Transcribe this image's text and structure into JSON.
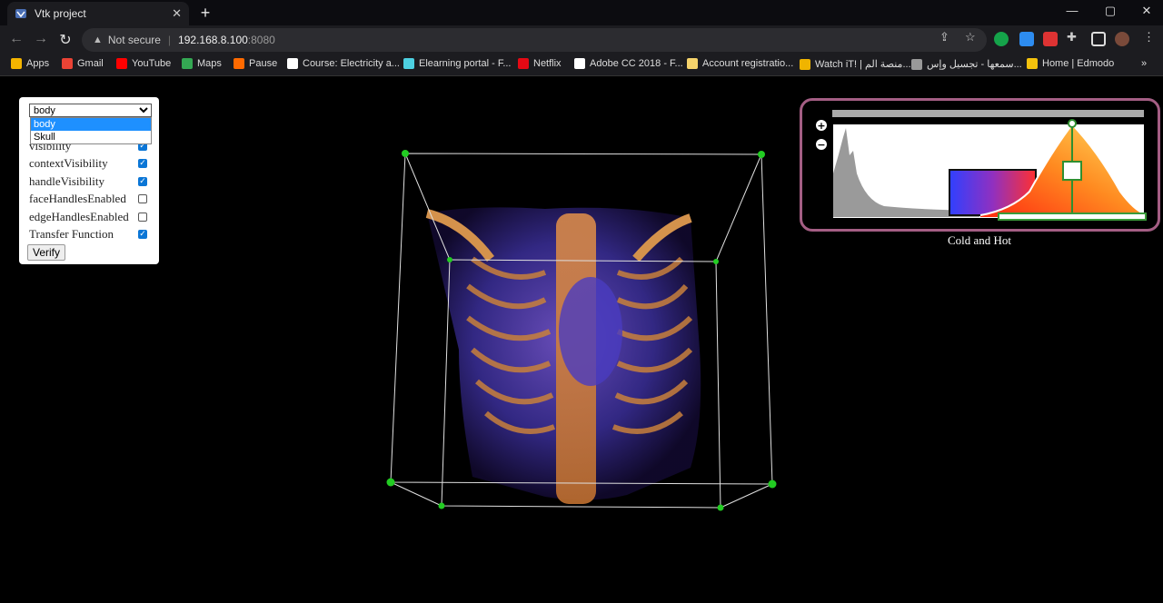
{
  "tab": {
    "title": "Vtk project",
    "close": "✕",
    "new": "+"
  },
  "window_controls": {
    "minimize": "—",
    "maximize": "▢",
    "close": "✕"
  },
  "nav": {
    "back": "←",
    "forward": "→",
    "reload": "↻"
  },
  "omnibox": {
    "security_label": "Not secure",
    "host": "192.168.8.100",
    "port": ":8080"
  },
  "bookmarks": [
    {
      "label": "Apps",
      "color": "#f4b400"
    },
    {
      "label": "Gmail",
      "color": "#ea4335"
    },
    {
      "label": "YouTube",
      "color": "#ff0000"
    },
    {
      "label": "Maps",
      "color": "#34a853"
    },
    {
      "label": "Pause",
      "color": "#ff6a00"
    },
    {
      "label": "Course: Electricity a...",
      "color": "#ffffff"
    },
    {
      "label": "Elearning portal - F...",
      "color": "#4dd0e1"
    },
    {
      "label": "Netflix",
      "color": "#e50914"
    },
    {
      "label": "Adobe CC 2018 - F...",
      "color": "#ffffff"
    },
    {
      "label": "Account registratio...",
      "color": "#f5d36b"
    },
    {
      "label": "Watch iT! | منصة الم...",
      "color": "#f0b400"
    },
    {
      "label": "سمعها - تجسيل وإس...",
      "color": "#999999"
    },
    {
      "label": "Home | Edmodo",
      "color": "#f4c20d"
    },
    {
      "label": "»",
      "color": ""
    }
  ],
  "panel": {
    "select_value": "body",
    "options": [
      "body",
      "Skull"
    ],
    "rows": [
      {
        "label": "visibility",
        "checked": true
      },
      {
        "label": "contextVisibility",
        "checked": true
      },
      {
        "label": "handleVisibility",
        "checked": true
      },
      {
        "label": "faceHandlesEnabled",
        "checked": false
      },
      {
        "label": "edgeHandlesEnabled",
        "checked": false
      },
      {
        "label": "Transfer Function",
        "checked": true
      }
    ],
    "verify_label": "Verify"
  },
  "transfer_function": {
    "caption": "Cold and Hot",
    "zoom_in": "+",
    "zoom_out": "−"
  },
  "colors": {
    "accent_green": "#22cc22",
    "frame_pink": "#a45e84"
  }
}
